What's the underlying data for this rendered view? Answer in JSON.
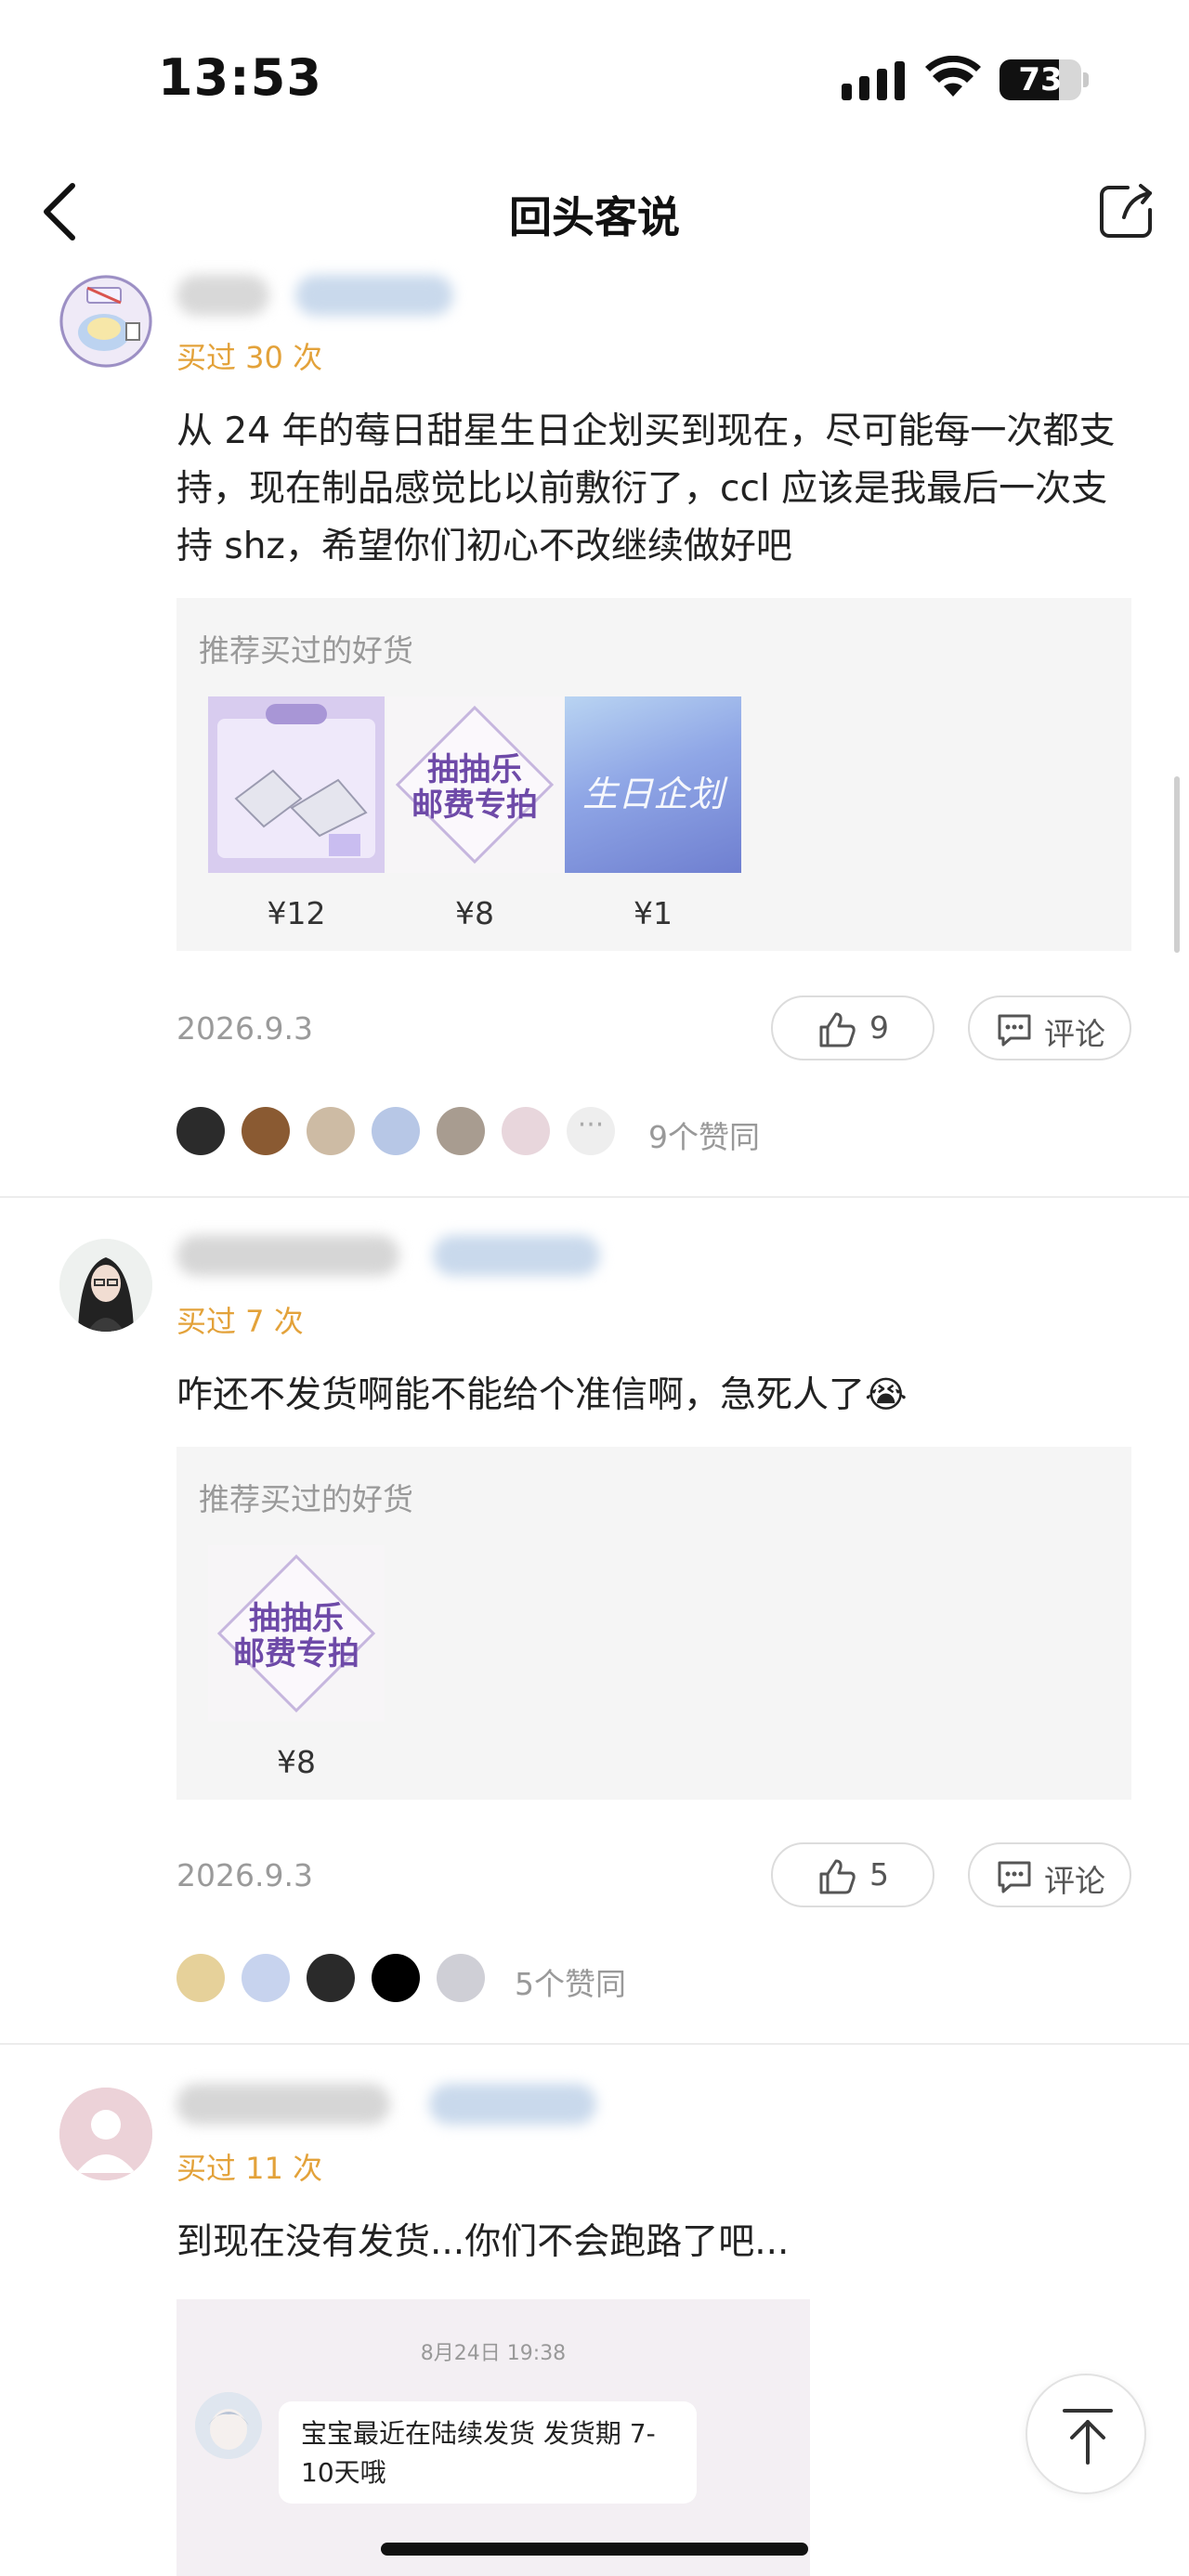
{
  "status_bar": {
    "time": "13:53",
    "battery": "73",
    "battery_level": 0.73
  },
  "nav": {
    "title": "回头客说"
  },
  "reviews": [
    {
      "bought": "买过 30 次",
      "text": "从 24 年的莓日甜星生日企划买到现在，尽可能每一次都支持，现在制品感觉比以前敷衍了，ccl 应该是我最后一次支持 shz，希望你们初心不改继续做好吧",
      "rec_title": "推荐买过的好货",
      "products": [
        {
          "price": "¥12"
        },
        {
          "price": "¥8",
          "art_text_1": "抽抽乐",
          "art_text_2": "邮费专拍"
        },
        {
          "price": "¥1",
          "art_text": "生日企划"
        }
      ],
      "date": "2026.9.3",
      "likes": "9",
      "comment_label": "评论",
      "agree": "9个赞同"
    },
    {
      "bought": "买过 7 次",
      "text": "咋还不发货啊能不能给个准信啊，急死人了😭",
      "rec_title": "推荐买过的好货",
      "products": [
        {
          "price": "¥8",
          "art_text_1": "抽抽乐",
          "art_text_2": "邮费专拍"
        }
      ],
      "date": "2026.9.3",
      "likes": "5",
      "comment_label": "评论",
      "agree": "5个赞同"
    },
    {
      "bought": "买过 11 次",
      "text": "到现在没有发货...你们不会跑路了吧...",
      "chat": {
        "time": "8月24日 19:38",
        "message": "宝宝最近在陆续发货 发货期 7-10天哦"
      }
    }
  ]
}
